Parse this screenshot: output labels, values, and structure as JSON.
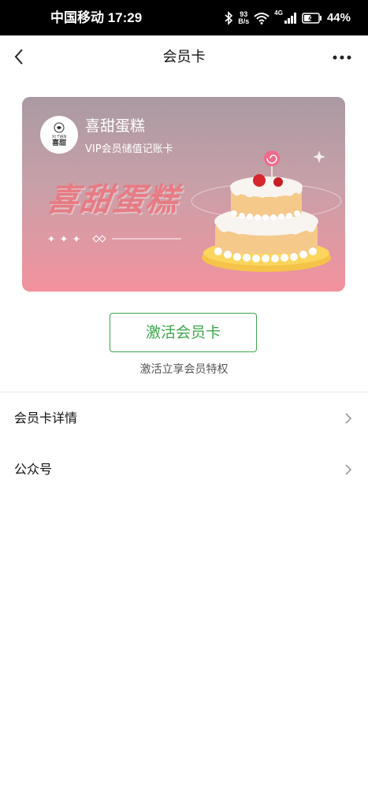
{
  "status_bar": {
    "carrier_time": "中国移动 17:29",
    "net_speed_value": "93",
    "net_speed_unit": "B/s",
    "network_type": "4G",
    "battery": "44%"
  },
  "nav": {
    "title": "会员卡"
  },
  "card": {
    "brand": "喜甜蛋糕",
    "subtitle": "VIP会员储值记账卡",
    "big_name": "喜甜蛋糕",
    "logo_small_text": "XI TIAN",
    "logo_main_text": "喜甜"
  },
  "activate": {
    "button_label": "激活会员卡",
    "hint": "激活立享会员特权"
  },
  "menu": {
    "items": [
      {
        "label": "会员卡详情"
      },
      {
        "label": "公众号"
      }
    ]
  },
  "colors": {
    "accent_green": "#3fa64e",
    "card_top": "#aa9aa3",
    "card_bottom": "#f3929e"
  }
}
